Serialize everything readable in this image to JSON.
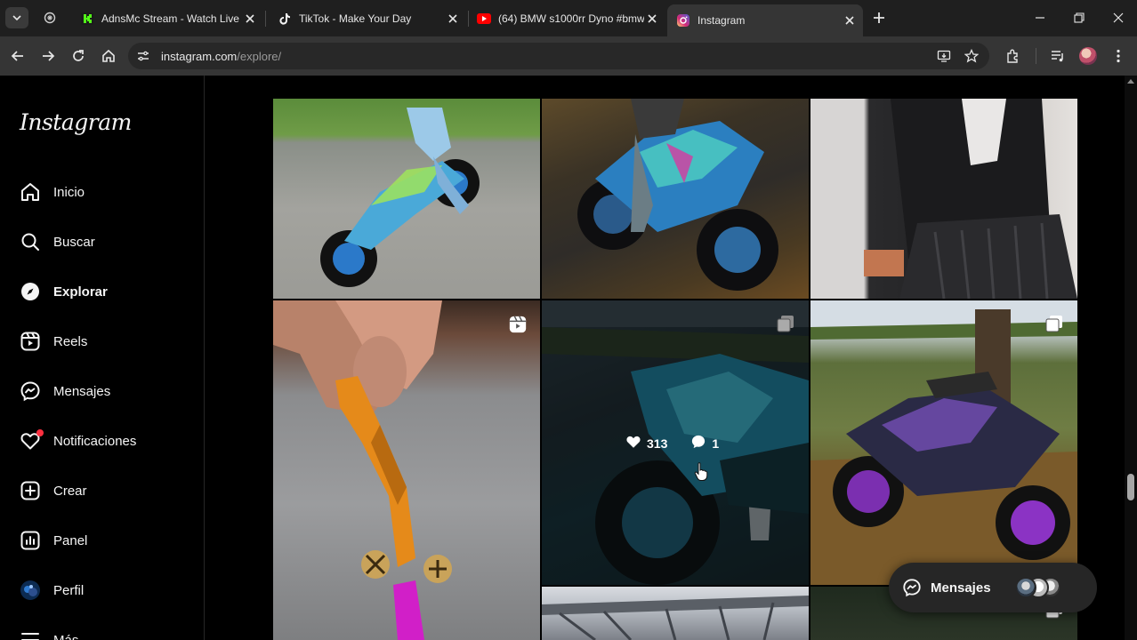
{
  "browser": {
    "tabs": [
      {
        "title": "AdnsMc Stream - Watch Live or",
        "favicon": "kick-icon"
      },
      {
        "title": "TikTok - Make Your Day",
        "favicon": "tiktok-icon"
      },
      {
        "title": "(64) BMW s1000rr Dyno #bmw",
        "favicon": "youtube-icon"
      },
      {
        "title": "Instagram",
        "favicon": "instagram-icon",
        "active": true
      }
    ],
    "url_host": "instagram.com",
    "url_path": "/explore/"
  },
  "instagram": {
    "logo": "Instagram",
    "nav": [
      {
        "label": "Inicio",
        "icon": "home-icon"
      },
      {
        "label": "Buscar",
        "icon": "search-icon"
      },
      {
        "label": "Explorar",
        "icon": "compass-icon",
        "active": true
      },
      {
        "label": "Reels",
        "icon": "reels-icon"
      },
      {
        "label": "Mensajes",
        "icon": "messenger-icon"
      },
      {
        "label": "Notificaciones",
        "icon": "heart-icon",
        "has_dot": true
      },
      {
        "label": "Crear",
        "icon": "plus-square-icon"
      },
      {
        "label": "Panel",
        "icon": "chart-icon"
      },
      {
        "label": "Perfil",
        "icon": "avatar"
      },
      {
        "label": "Más",
        "icon": "menu-icon"
      }
    ],
    "hover_post": {
      "likes": "313",
      "comments": "1"
    },
    "messages_pill": {
      "label": "Mensajes"
    }
  },
  "colors": {
    "background": "#000000",
    "notification": "#ff3040",
    "tab_active": "#353535"
  }
}
